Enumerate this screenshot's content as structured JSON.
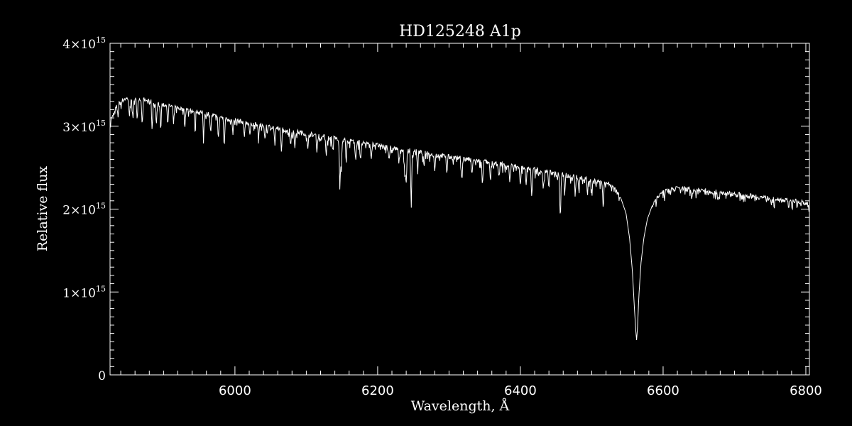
{
  "chart_data": {
    "type": "line",
    "title": "HD125248  A1p",
    "xlabel": "Wavelength, Å",
    "ylabel": "Relative flux",
    "xlim": [
      5825,
      6805
    ],
    "ylim": [
      0,
      4000000000000000.0
    ],
    "x_ticks": [
      6000,
      6200,
      6400,
      6600,
      6800
    ],
    "x_tick_labels": [
      "6000",
      "6200",
      "6400",
      "6600",
      "6800"
    ],
    "y_ticks": [
      0,
      1000000000000000.0,
      2000000000000000.0,
      3000000000000000.0,
      4000000000000000.0
    ],
    "y_tick_labels": [
      {
        "mantissa": "0",
        "exp": ""
      },
      {
        "mantissa": "1×10",
        "exp": "15"
      },
      {
        "mantissa": "2×10",
        "exp": "15"
      },
      {
        "mantissa": "3×10",
        "exp": "15"
      },
      {
        "mantissa": "4×10",
        "exp": "15"
      }
    ],
    "grid": false,
    "colors": {
      "background": "#000000",
      "line": "#ffffff",
      "axes": "#ffffff"
    },
    "series": [
      {
        "x": [
          5825,
          5835,
          5845,
          5860,
          5875,
          5900,
          5925,
          5950,
          5975,
          6000,
          6025,
          6050,
          6075,
          6100,
          6125,
          6150,
          6175,
          6200,
          6225,
          6250,
          6275,
          6300,
          6325,
          6350,
          6375,
          6400,
          6425,
          6450,
          6470,
          6490,
          6510,
          6520,
          6530,
          6540,
          6548,
          6553,
          6557,
          6560,
          6561.5,
          6562.8,
          6564,
          6566,
          6569,
          6573,
          6578,
          6585,
          6592,
          6600,
          6610,
          6620,
          6640,
          6660,
          6680,
          6700,
          6720,
          6740,
          6760,
          6780,
          6805
        ],
        "y": [
          3050000000000000.0,
          3250000000000000.0,
          3330000000000000.0,
          3340000000000000.0,
          3310000000000000.0,
          3260000000000000.0,
          3210000000000000.0,
          3170000000000000.0,
          3120000000000000.0,
          3070000000000000.0,
          3030000000000000.0,
          2990000000000000.0,
          2950000000000000.0,
          2910000000000000.0,
          2870000000000000.0,
          2840000000000000.0,
          2800000000000000.0,
          2770000000000000.0,
          2730000000000000.0,
          2700000000000000.0,
          2660000000000000.0,
          2630000000000000.0,
          2600000000000000.0,
          2570000000000000.0,
          2540000000000000.0,
          2510000000000000.0,
          2470000000000000.0,
          2430000000000000.0,
          2400000000000000.0,
          2370000000000000.0,
          2340000000000000.0,
          2320000000000000.0,
          2270000000000000.0,
          2150000000000000.0,
          1950000000000000.0,
          1650000000000000.0,
          1250000000000000.0,
          780000000000000.0,
          550000000000000.0,
          420000000000000.0,
          550000000000000.0,
          950000000000000.0,
          1350000000000000.0,
          1650000000000000.0,
          1880000000000000.0,
          2050000000000000.0,
          2150000000000000.0,
          2200000000000000.0,
          2240000000000000.0,
          2250000000000000.0,
          2240000000000000.0,
          2220000000000000.0,
          2200000000000000.0,
          2180000000000000.0,
          2160000000000000.0,
          2140000000000000.0,
          2120000000000000.0,
          2100000000000000.0,
          2070000000000000.0
        ]
      }
    ],
    "absorption_lines": [
      {
        "x": 5836,
        "depth": 150000000000000.0
      },
      {
        "x": 5852,
        "depth": 200000000000000.0
      },
      {
        "x": 5857,
        "depth": 300000000000000.0
      },
      {
        "x": 5863,
        "depth": 250000000000000.0
      },
      {
        "x": 5870,
        "depth": 300000000000000.0
      },
      {
        "x": 5884,
        "depth": 350000000000000.0
      },
      {
        "x": 5890,
        "depth": 280000000000000.0
      },
      {
        "x": 5896,
        "depth": 330000000000000.0
      },
      {
        "x": 5906,
        "depth": 250000000000000.0
      },
      {
        "x": 5914,
        "depth": 220000000000000.0
      },
      {
        "x": 5930,
        "depth": 180000000000000.0
      },
      {
        "x": 5944,
        "depth": 220000000000000.0
      },
      {
        "x": 5956,
        "depth": 300000000000000.0
      },
      {
        "x": 5966,
        "depth": 240000000000000.0
      },
      {
        "x": 5977,
        "depth": 280000000000000.0
      },
      {
        "x": 5985,
        "depth": 380000000000000.0
      },
      {
        "x": 5997,
        "depth": 180000000000000.0
      },
      {
        "x": 6013,
        "depth": 200000000000000.0
      },
      {
        "x": 6021,
        "depth": 160000000000000.0
      },
      {
        "x": 6033,
        "depth": 150000000000000.0
      },
      {
        "x": 6042,
        "depth": 140000000000000.0
      },
      {
        "x": 6056,
        "depth": 220000000000000.0
      },
      {
        "x": 6065,
        "depth": 260000000000000.0
      },
      {
        "x": 6078,
        "depth": 200000000000000.0
      },
      {
        "x": 6084,
        "depth": 180000000000000.0
      },
      {
        "x": 6102,
        "depth": 220000000000000.0
      },
      {
        "x": 6115,
        "depth": 200000000000000.0
      },
      {
        "x": 6128,
        "depth": 220000000000000.0
      },
      {
        "x": 6137,
        "depth": 160000000000000.0
      },
      {
        "x": 6147,
        "depth": 560000000000000.0
      },
      {
        "x": 6149,
        "depth": 400000000000000.0
      },
      {
        "x": 6156,
        "depth": 280000000000000.0
      },
      {
        "x": 6169,
        "depth": 200000000000000.0
      },
      {
        "x": 6176,
        "depth": 220000000000000.0
      },
      {
        "x": 6191,
        "depth": 180000000000000.0
      },
      {
        "x": 6216,
        "depth": 160000000000000.0
      },
      {
        "x": 6230,
        "depth": 170000000000000.0
      },
      {
        "x": 6238,
        "depth": 350000000000000.0
      },
      {
        "x": 6240,
        "depth": 450000000000000.0
      },
      {
        "x": 6247,
        "depth": 700000000000000.0
      },
      {
        "x": 6256,
        "depth": 220000000000000.0
      },
      {
        "x": 6265,
        "depth": 200000000000000.0
      },
      {
        "x": 6280,
        "depth": 180000000000000.0
      },
      {
        "x": 6297,
        "depth": 200000000000000.0
      },
      {
        "x": 6318,
        "depth": 240000000000000.0
      },
      {
        "x": 6332,
        "depth": 200000000000000.0
      },
      {
        "x": 6347,
        "depth": 280000000000000.0
      },
      {
        "x": 6358,
        "depth": 220000000000000.0
      },
      {
        "x": 6370,
        "depth": 200000000000000.0
      },
      {
        "x": 6385,
        "depth": 220000000000000.0
      },
      {
        "x": 6400,
        "depth": 240000000000000.0
      },
      {
        "x": 6408,
        "depth": 220000000000000.0
      },
      {
        "x": 6416,
        "depth": 400000000000000.0
      },
      {
        "x": 6432,
        "depth": 240000000000000.0
      },
      {
        "x": 6440,
        "depth": 200000000000000.0
      },
      {
        "x": 6456,
        "depth": 580000000000000.0
      },
      {
        "x": 6462,
        "depth": 220000000000000.0
      },
      {
        "x": 6477,
        "depth": 200000000000000.0
      },
      {
        "x": 6482,
        "depth": 200000000000000.0
      },
      {
        "x": 6494,
        "depth": 180000000000000.0
      },
      {
        "x": 6500,
        "depth": 160000000000000.0
      },
      {
        "x": 6516,
        "depth": 300000000000000.0
      },
      {
        "x": 6640,
        "depth": 120000000000000.0
      },
      {
        "x": 6677,
        "depth": 100000000000000.0
      }
    ]
  }
}
